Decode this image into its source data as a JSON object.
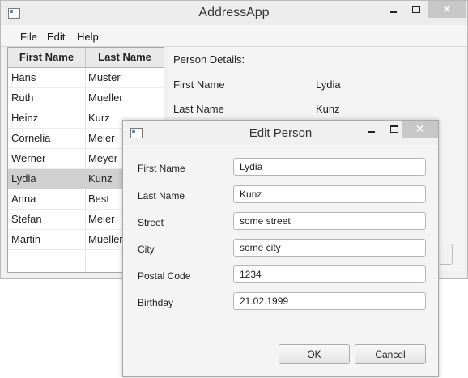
{
  "main_window": {
    "title": "AddressApp",
    "controls": {
      "minimize": "–",
      "maximize": "□",
      "close": "✕"
    }
  },
  "menu": [
    "File",
    "Edit",
    "Help"
  ],
  "table": {
    "headers": [
      "First Name",
      "Last Name"
    ],
    "rows": [
      [
        "Hans",
        "Muster"
      ],
      [
        "Ruth",
        "Mueller"
      ],
      [
        "Heinz",
        "Kurz"
      ],
      [
        "Cornelia",
        "Meier"
      ],
      [
        "Werner",
        "Meyer"
      ],
      [
        "Lydia",
        "Kunz"
      ],
      [
        "Anna",
        "Best"
      ],
      [
        "Stefan",
        "Meier"
      ],
      [
        "Martin",
        "Mueller"
      ]
    ],
    "selected_index": 5
  },
  "details": {
    "heading": "Person Details:",
    "first_name_label": "First Name",
    "first_name_value": "Lydia",
    "last_name_label": "Last Name",
    "last_name_value": "Kunz"
  },
  "dialog": {
    "title": "Edit Person",
    "controls": {
      "minimize": "–",
      "maximize": "□",
      "close": "✕"
    },
    "fields": [
      {
        "label": "First Name",
        "value": "Lydia"
      },
      {
        "label": "Last Name",
        "value": "Kunz"
      },
      {
        "label": "Street",
        "value": "some street"
      },
      {
        "label": "City",
        "value": "some city"
      },
      {
        "label": "Postal Code",
        "value": "1234"
      },
      {
        "label": "Birthday",
        "value": "21.02.1999"
      }
    ],
    "ok_label": "OK",
    "cancel_label": "Cancel"
  }
}
